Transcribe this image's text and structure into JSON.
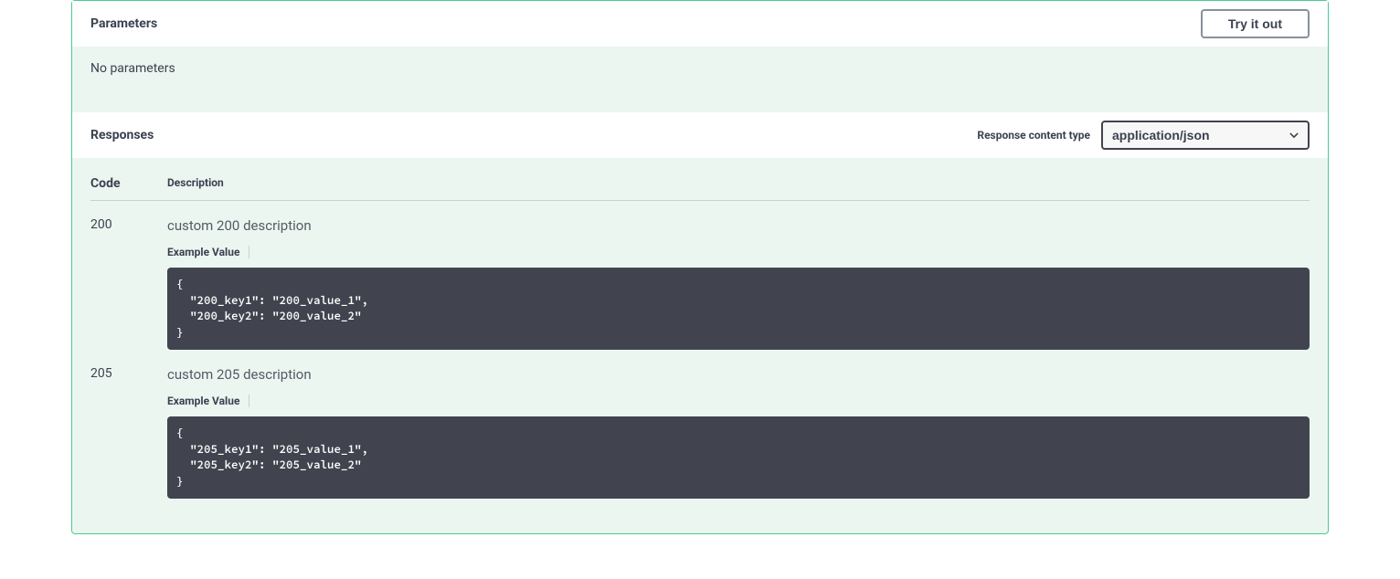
{
  "parameters": {
    "title": "Parameters",
    "try_button": "Try it out",
    "empty_text": "No parameters"
  },
  "responses": {
    "title": "Responses",
    "content_type_label": "Response content type",
    "content_type_value": "application/json",
    "columns": {
      "code": "Code",
      "description": "Description"
    },
    "rows": [
      {
        "code": "200",
        "description": "custom 200 description",
        "example_label": "Example Value",
        "example": "{\n  \"200_key1\": \"200_value_1\",\n  \"200_key2\": \"200_value_2\"\n}"
      },
      {
        "code": "205",
        "description": "custom 205 description",
        "example_label": "Example Value",
        "example": "{\n  \"205_key1\": \"205_value_1\",\n  \"205_key2\": \"205_value_2\"\n}"
      }
    ]
  }
}
